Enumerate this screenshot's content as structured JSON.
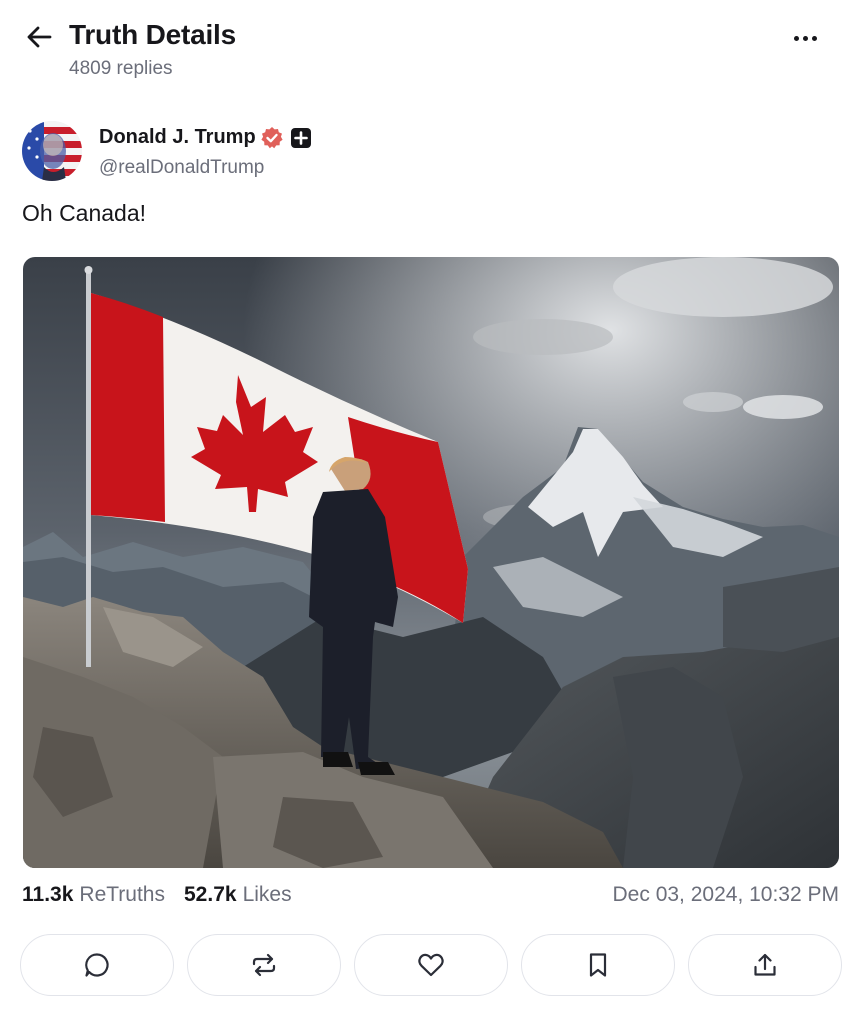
{
  "header": {
    "title": "Truth Details",
    "replies": "4809 replies",
    "back_icon": "arrow-left-icon",
    "more_icon": "more-horizontal-icon"
  },
  "post": {
    "author": {
      "name": "Donald J. Trump",
      "handle": "@realDonaldTrump",
      "verified_icon": "verified-badge-icon",
      "plus_icon": "plus-badge-icon",
      "verified_color": "#e0605a"
    },
    "text": "Oh Canada!",
    "media_alt": "image-post",
    "stats": {
      "retruths_count": "11.3k",
      "retruths_label": "ReTruths",
      "likes_count": "52.7k",
      "likes_label": "Likes"
    },
    "timestamp": "Dec 03, 2024, 10:32 PM"
  },
  "actions": [
    {
      "icon": "reply-icon"
    },
    {
      "icon": "retruth-icon"
    },
    {
      "icon": "like-icon"
    },
    {
      "icon": "bookmark-icon"
    },
    {
      "icon": "share-icon"
    }
  ],
  "colors": {
    "text_primary": "#17171b",
    "text_secondary": "#6b6e7a",
    "border": "#e2e4ea",
    "flag_red": "#c8141b"
  }
}
